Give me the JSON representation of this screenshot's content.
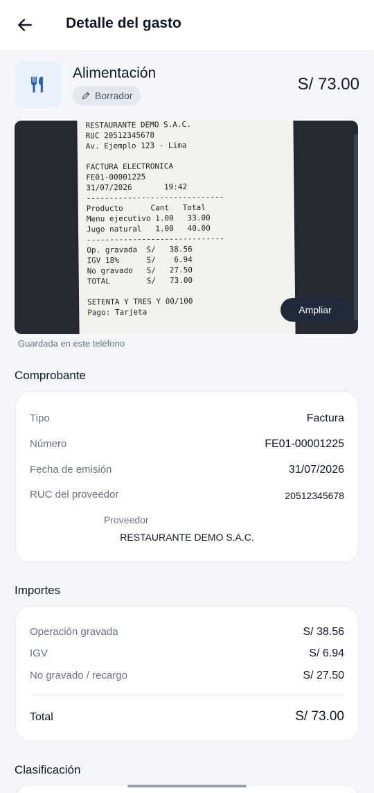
{
  "header": {
    "title": "Detalle del gasto",
    "back_icon": "arrow-left-icon"
  },
  "expense": {
    "category": "Alimentación",
    "category_icon": "utensils-icon",
    "status": "Borrador",
    "status_icon": "pencil-icon",
    "amount": "S/ 73.00"
  },
  "receipt": {
    "lines": "RESTAURANTE DEMO S.A.C.\nRUC 20512345678\nAv. Ejemplo 123 - Lima\n\nFACTURA ELECTRONICA\nFE01-00001225\n31/07/2026       19:42\n------------------------------\nProducto      Cant   Total\nMenu ejecutivo 1.00   33.00\nJugo natural   1.00   40.00\n------------------------------\nOp. gravada  S/   38.56\nIGV 18%      S/    6.94\nNo gravado   S/   27.50\nTOTAL        S/   73.00\n\nSETENTA Y TRES Y 00/100\nPago: Tarjeta",
    "zoom_label": "Ampliar",
    "saved_note": "Guardada en este teléfono"
  },
  "comprobante": {
    "title": "Comprobante",
    "tipo_label": "Tipo",
    "tipo_value": "Factura",
    "numero_label": "Número",
    "numero_value": "FE01-00001225",
    "fecha_label": "Fecha de emisión",
    "fecha_value": "31/07/2026",
    "ruc_label": "RUC del proveedor",
    "ruc_value": "20512345678",
    "proveedor_label": "Proveedor",
    "proveedor_value": "RESTAURANTE DEMO S.A.C."
  },
  "importes": {
    "title": "Importes",
    "gravada_label": "Operación gravada",
    "gravada_value": "S/ 38.56",
    "igv_label": "IGV",
    "igv_value": "S/ 6.94",
    "nogravado_label": "No gravado / recargo",
    "nogravado_value": "S/ 27.50",
    "total_label": "Total",
    "total_value": "S/ 73.00"
  },
  "clasificacion": {
    "title": "Clasificación"
  },
  "colors": {
    "accent": "#1f5fbf",
    "background": "#f4f6fa",
    "button_dark": "#202a3a"
  }
}
